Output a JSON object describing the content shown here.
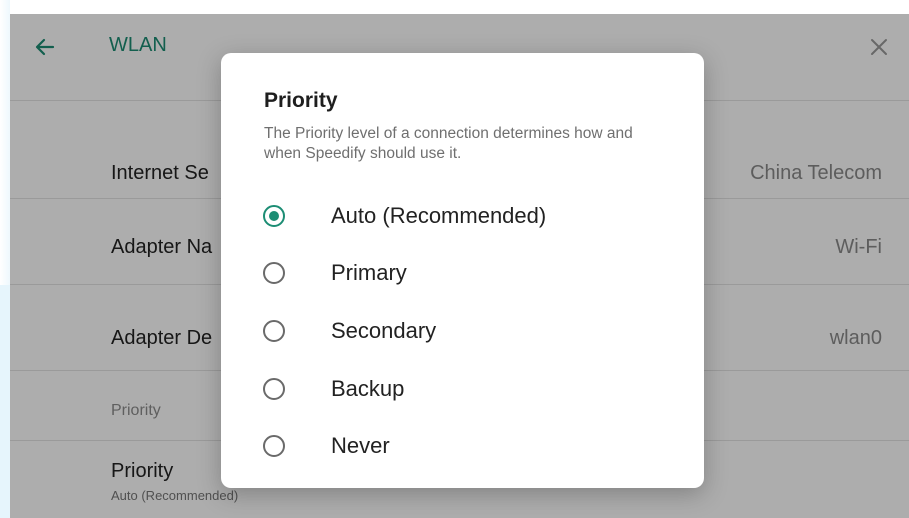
{
  "header": {
    "title": "WLAN",
    "back_icon": "arrow-left-icon",
    "close_icon": "close-icon"
  },
  "rows": [
    {
      "label": "Internet Se",
      "value": "China Telecom"
    },
    {
      "label": "Adapter Na",
      "value": "Wi-Fi"
    },
    {
      "label": "Adapter De",
      "value": "wlan0"
    }
  ],
  "section": {
    "header": "Priority"
  },
  "priority_item": {
    "title": "Priority",
    "subtitle": "Auto (Recommended)"
  },
  "dialog": {
    "title": "Priority",
    "description": "The Priority level of a connection determines how and when Speedify should use it.",
    "selected_index": 0,
    "options": [
      {
        "label": "Auto (Recommended)"
      },
      {
        "label": "Primary"
      },
      {
        "label": "Secondary"
      },
      {
        "label": "Backup"
      },
      {
        "label": "Never"
      }
    ]
  },
  "colors": {
    "accent": "#1c8d74",
    "scrim": "rgba(0,0,0,0.32)",
    "edge": "#e6f5fc"
  }
}
